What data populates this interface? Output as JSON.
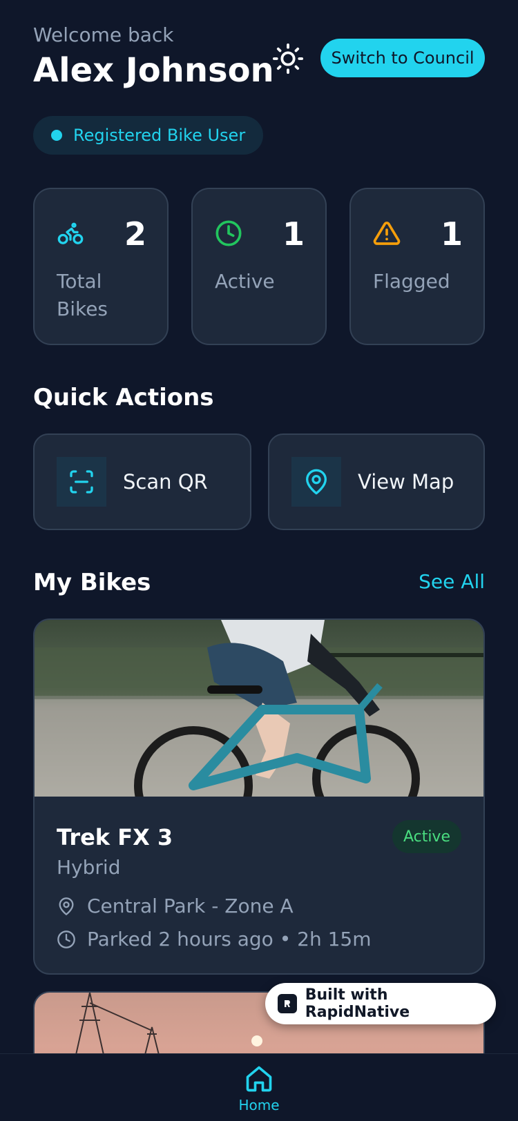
{
  "header": {
    "welcome": "Welcome back",
    "username": "Alex Johnson",
    "theme_icon": "sun-icon",
    "switch_label": "Switch to Council"
  },
  "role_badge": {
    "label": "Registered Bike User"
  },
  "stats": [
    {
      "icon": "bike-icon",
      "value": "2",
      "label": "Total Bikes",
      "color": "#22d3ee"
    },
    {
      "icon": "clock-icon",
      "value": "1",
      "label": "Active",
      "color": "#22c55e"
    },
    {
      "icon": "warning-icon",
      "value": "1",
      "label": "Flagged",
      "color": "#f59e0b"
    }
  ],
  "quick_actions": {
    "title": "Quick Actions",
    "items": [
      {
        "icon": "scan-qr-icon",
        "label": "Scan QR"
      },
      {
        "icon": "map-pin-icon",
        "label": "View Map"
      }
    ]
  },
  "my_bikes": {
    "title": "My Bikes",
    "see_all": "See All",
    "bikes": [
      {
        "name": "Trek FX 3",
        "type": "Hybrid",
        "status": "Active",
        "location": "Central Park - Zone A",
        "parked": "Parked 2 hours ago • 2h 15m"
      }
    ]
  },
  "built_badge": {
    "label": "Built with RapidNative"
  },
  "tab_bar": {
    "home_label": "Home"
  },
  "colors": {
    "accent": "#22d3ee",
    "background": "#0f172a",
    "card": "#1e293b",
    "active": "#4ade80"
  }
}
